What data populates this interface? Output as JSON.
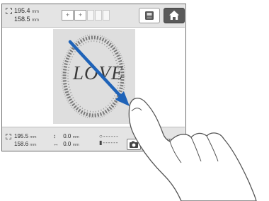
{
  "top_bar": {
    "width_value": "195.4",
    "width_unit": "mm",
    "height_value": "158.5",
    "height_unit": "mm",
    "thread_slots": [
      "+",
      "+"
    ]
  },
  "canvas": {
    "design_text": "LOVE"
  },
  "bottom_bar": {
    "width_value": "195.5",
    "width_unit": "mm",
    "height_value": "158.6",
    "height_unit": "mm",
    "move_vertical_value": "0.0",
    "move_vertical_unit": "mm",
    "move_horizontal_value": "0.0",
    "move_horizontal_unit": "mm",
    "thread_row_1": "------",
    "thread_row_2": "------"
  },
  "colors": {
    "drag_arrow": "#1f63b8",
    "hoop_background": "#dedede",
    "toolbar": "#e4e4e4"
  },
  "icons": {
    "memory": "memory-card-icon",
    "home": "home-icon",
    "camera": "camera-icon",
    "zoom": "zoom-in-icon"
  }
}
